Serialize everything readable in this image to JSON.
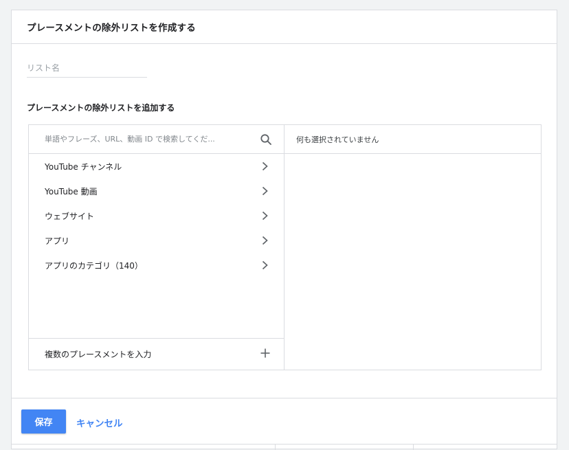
{
  "dialog": {
    "title": "プレースメントの除外リストを作成する"
  },
  "list_name": {
    "placeholder": "リスト名",
    "value": ""
  },
  "section": {
    "label": "プレースメントの除外リストを追加する"
  },
  "picker": {
    "search_placeholder": "単語やフレーズ、URL、動画 ID で検索してくだ...",
    "selected_empty_text": "何も選択されていません",
    "categories": [
      {
        "label": "YouTube チャンネル",
        "icon": "chevron-right-icon"
      },
      {
        "label": "YouTube 動画",
        "icon": "chevron-right-icon"
      },
      {
        "label": "ウェブサイト",
        "icon": "chevron-right-icon"
      },
      {
        "label": "アプリ",
        "icon": "chevron-right-icon"
      },
      {
        "label": "アプリのカテゴリ（140）",
        "icon": "chevron-right-icon"
      }
    ],
    "multi_entry_label": "複数のプレースメントを入力"
  },
  "footer": {
    "save_label": "保存",
    "cancel_label": "キャンセル"
  },
  "colors": {
    "accent": "#4285f4",
    "border": "#dadce0",
    "background": "#f1f3f4"
  }
}
